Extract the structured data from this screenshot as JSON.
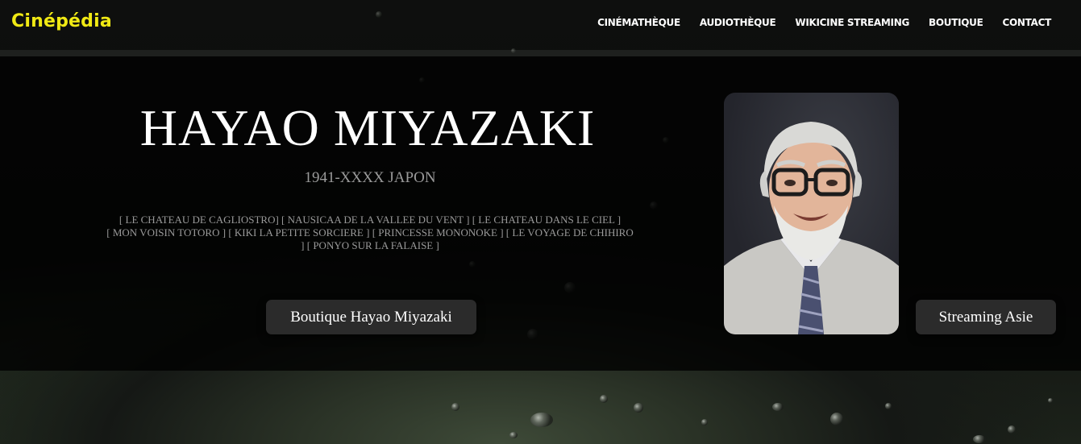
{
  "brand": "Cinépédia",
  "nav": {
    "items": [
      {
        "label": "CINÉMATHÈQUE"
      },
      {
        "label": "AUDIOTHÈQUE"
      },
      {
        "label": "WIKICINE STREAMING"
      },
      {
        "label": "BOUTIQUE"
      },
      {
        "label": "CONTACT"
      }
    ]
  },
  "hero": {
    "title": "HAYAO MIYAZAKI",
    "subtitle": "1941-XXXX JAPON",
    "films_line1": "[ LE CHATEAU DE CAGLIOSTRO] [ NAUSICAA DE LA VALLEE DU VENT ] [ LE CHATEAU DANS LE CIEL ]",
    "films_line2": "[ MON VOISIN TOTORO ] [ KIKI LA PETITE SORCIERE ] [ PRINCESSE MONONOKE ] [ LE VOYAGE DE CHIHIRO",
    "films_line3": "] [ PONYO SUR LA FALAISE ]",
    "boutique_button": "Boutique Hayao Miyazaki",
    "streaming_button": "Streaming Asie"
  },
  "colors": {
    "brand": "#f0e914",
    "nav_text": "#ffffff",
    "muted_text": "#9a9a9a",
    "button_bg": "#2b2b2b"
  }
}
